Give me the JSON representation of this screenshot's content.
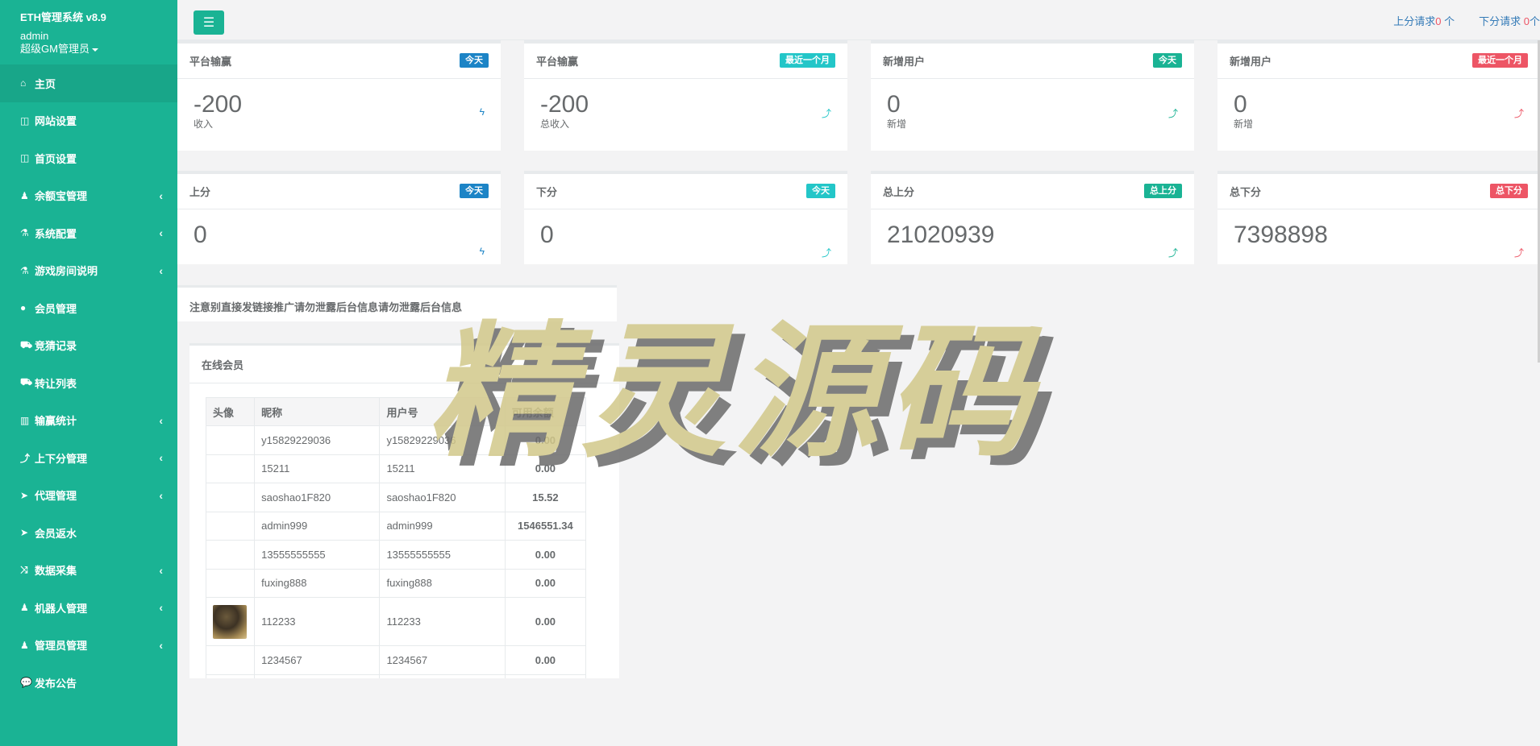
{
  "sidebar": {
    "system_name": "ETH管理系统 v8.9",
    "username": "admin",
    "role": "超级GM管理员",
    "items": [
      {
        "label": "主页",
        "icon": "home-icon",
        "glyph": "⌂",
        "has_submenu": false,
        "active": true
      },
      {
        "label": "网站设置",
        "icon": "columns-icon",
        "glyph": "◫",
        "has_submenu": false
      },
      {
        "label": "首页设置",
        "icon": "columns-icon",
        "glyph": "◫",
        "has_submenu": false
      },
      {
        "label": "余额宝管理",
        "icon": "male-icon",
        "glyph": "♟",
        "has_submenu": true
      },
      {
        "label": "系统配置",
        "icon": "flask-icon",
        "glyph": "⚗",
        "has_submenu": true
      },
      {
        "label": "游戏房间说明",
        "icon": "flask-icon",
        "glyph": "⚗",
        "has_submenu": true
      },
      {
        "label": "会员管理",
        "icon": "user-icon",
        "glyph": "●",
        "has_submenu": false
      },
      {
        "label": "竞猜记录",
        "icon": "car-icon",
        "glyph": "⛟",
        "has_submenu": false
      },
      {
        "label": "转让列表",
        "icon": "car-icon",
        "glyph": "⛟",
        "has_submenu": false
      },
      {
        "label": "输赢统计",
        "icon": "bar-chart-icon",
        "glyph": "▥",
        "has_submenu": true
      },
      {
        "label": "上下分管理",
        "icon": "level-up-icon",
        "glyph": "⤴",
        "has_submenu": true
      },
      {
        "label": "代理管理",
        "icon": "paper-plane-icon",
        "glyph": "➤",
        "has_submenu": true
      },
      {
        "label": "会员返水",
        "icon": "paper-plane-icon",
        "glyph": "➤",
        "has_submenu": false
      },
      {
        "label": "数据采集",
        "icon": "random-icon",
        "glyph": "⤨",
        "has_submenu": true
      },
      {
        "label": "机器人管理",
        "icon": "male-icon",
        "glyph": "♟",
        "has_submenu": true
      },
      {
        "label": "管理员管理",
        "icon": "male-icon",
        "glyph": "♟",
        "has_submenu": true
      },
      {
        "label": "发布公告",
        "icon": "comment-icon",
        "glyph": "💬",
        "has_submenu": false
      }
    ]
  },
  "topbar": {
    "up_request_label": "上分请求",
    "up_request_count": "0",
    "up_request_unit": "个",
    "down_request_label": "下分请求",
    "down_request_count": "0",
    "down_request_unit": "个"
  },
  "stats": [
    {
      "title": "平台输赢",
      "badge": "今天",
      "value": "-200",
      "sub": "收入",
      "glyph": "ϟ"
    },
    {
      "title": "平台输赢",
      "badge": "最近一个月",
      "value": "-200",
      "sub": "总收入",
      "glyph": "⤴"
    },
    {
      "title": "新增用户",
      "badge": "今天",
      "value": "0",
      "sub": "新增",
      "glyph": "⤴"
    },
    {
      "title": "新增用户",
      "badge": "最近一个月",
      "value": "0",
      "sub": "新增",
      "glyph": "⤴"
    },
    {
      "title": "上分",
      "badge": "今天",
      "value": "0",
      "sub": "",
      "glyph": "ϟ"
    },
    {
      "title": "下分",
      "badge": "今天",
      "value": "0",
      "sub": "",
      "glyph": "⤴"
    },
    {
      "title": "总上分",
      "badge": "总上分",
      "value": "21020939",
      "sub": "",
      "glyph": "⤴"
    },
    {
      "title": "总下分",
      "badge": "总下分",
      "value": "7398898",
      "sub": "",
      "glyph": "⤴"
    }
  ],
  "notice": "注意别直接发链接推广请勿泄露后台信息请勿泄露后台信息",
  "online": {
    "title": "在线会员",
    "headers": [
      "头像",
      "昵称",
      "用户号",
      "可用余额"
    ],
    "rows": [
      {
        "nickname": "y15829229036",
        "userid": "y15829229036",
        "balance": "0.00"
      },
      {
        "nickname": "15211",
        "userid": "15211",
        "balance": "0.00"
      },
      {
        "nickname": "saoshao1F820",
        "userid": "saoshao1F820",
        "balance": "15.52"
      },
      {
        "nickname": "admin999",
        "userid": "admin999",
        "balance": "1546551.34"
      },
      {
        "nickname": "13555555555",
        "userid": "13555555555",
        "balance": "0.00"
      },
      {
        "nickname": "fuxing888",
        "userid": "fuxing888",
        "balance": "0.00"
      },
      {
        "nickname": "112233",
        "userid": "112233",
        "balance": "0.00",
        "avatar": true
      },
      {
        "nickname": "1234567",
        "userid": "1234567",
        "balance": "0.00"
      }
    ]
  },
  "watermark": "精灵源码",
  "colors": {
    "brand": "#1ab394",
    "blue": "#1c84c6",
    "cyan": "#23c6c8",
    "red": "#ed5565"
  }
}
